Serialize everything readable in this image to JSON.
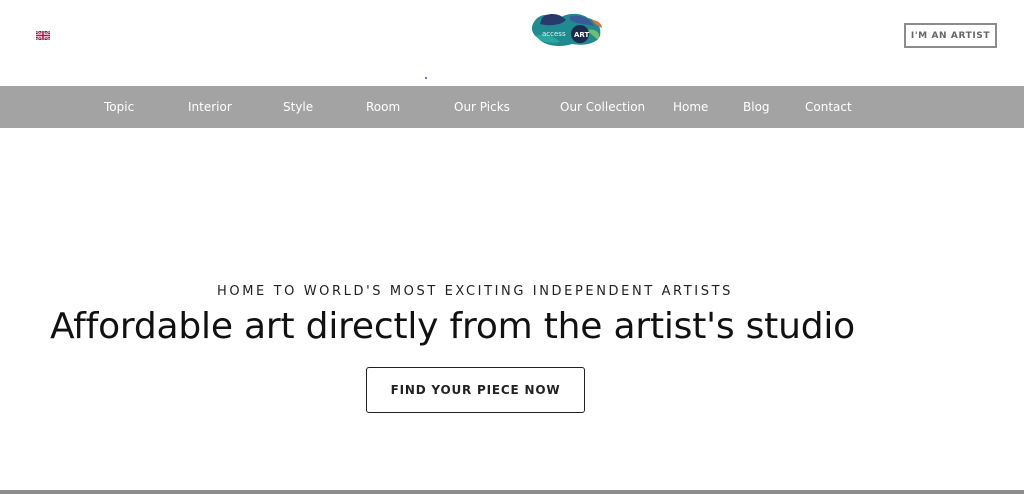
{
  "header": {
    "language_icon": "uk-flag-icon",
    "logo": {
      "icon": "access-art-logo",
      "text_small": "access",
      "text_main": "ART"
    },
    "artist_button_label": "I'M AN ARTIST"
  },
  "nav": {
    "items": [
      {
        "label": "Topic"
      },
      {
        "label": "Interior"
      },
      {
        "label": "Style"
      },
      {
        "label": "Room"
      },
      {
        "label": "Our Picks"
      },
      {
        "label": "Our Collection"
      },
      {
        "label": "Home"
      },
      {
        "label": "Blog"
      },
      {
        "label": "Contact"
      }
    ]
  },
  "hero": {
    "tagline": "HOME TO WORLD'S MOST EXCITING INDEPENDENT ARTISTS",
    "headline": "Affordable art directly from the artist's studio",
    "cta_label": "FIND YOUR PIECE NOW"
  },
  "colors": {
    "nav_background": "#a3a3a3",
    "nav_text": "#ffffff",
    "button_border": "#8c8c8c",
    "logo_teal": "#1f8a8f",
    "logo_navy": "#263a6b"
  }
}
